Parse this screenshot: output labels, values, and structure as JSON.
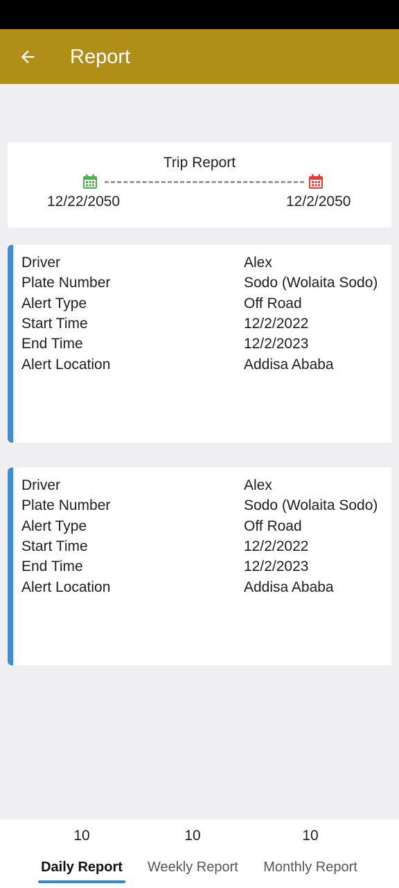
{
  "header": {
    "title": "Report"
  },
  "trip": {
    "title": "Trip Report",
    "start_date": "12/22/2050",
    "end_date": "12/2/2050",
    "start_icon_color": "#4caf50",
    "end_icon_color": "#e53935"
  },
  "alerts": [
    {
      "rows": [
        {
          "label": "Driver",
          "value": "Alex"
        },
        {
          "label": "Plate Number",
          "value": "Sodo (Wolaita Sodo)"
        },
        {
          "label": "Alert Type",
          "value": "Off Road"
        },
        {
          "label": "Start Time",
          "value": "12/2/2022"
        },
        {
          "label": "End Time",
          "value": "12/2/2023"
        },
        {
          "label": "Alert Location",
          "value": "Addisa Ababa"
        }
      ]
    },
    {
      "rows": [
        {
          "label": "Driver",
          "value": "Alex"
        },
        {
          "label": "Plate Number",
          "value": "Sodo (Wolaita Sodo)"
        },
        {
          "label": "Alert Type",
          "value": "Off Road"
        },
        {
          "label": "Start Time",
          "value": "12/2/2022"
        },
        {
          "label": "End Time",
          "value": "12/2/2023"
        },
        {
          "label": "Alert Location",
          "value": "Addisa Ababa"
        }
      ]
    }
  ],
  "tabs": [
    {
      "count": "10",
      "label": "Daily Report"
    },
    {
      "count": "10",
      "label": "Weekly Report"
    },
    {
      "count": "10",
      "label": "Monthly Report"
    }
  ],
  "colors": {
    "app_bar": "#b08e18",
    "accent": "#3b8fd6"
  }
}
